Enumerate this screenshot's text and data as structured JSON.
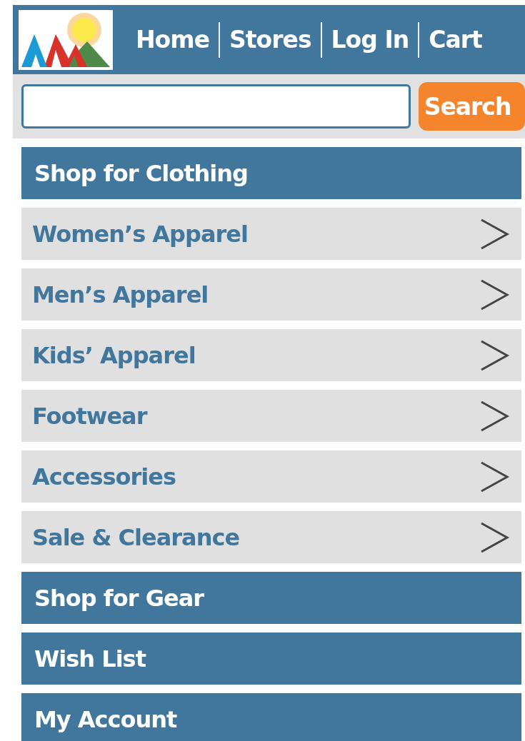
{
  "nav": {
    "links": [
      "Home",
      "Stores",
      "Log In",
      "Cart"
    ]
  },
  "search": {
    "button": "Search"
  },
  "menu": [
    {
      "kind": "heading",
      "label": "Shop for Clothing"
    },
    {
      "kind": "item",
      "label": "Women’s Apparel"
    },
    {
      "kind": "item",
      "label": "Men’s Apparel"
    },
    {
      "kind": "item",
      "label": "Kids’ Apparel"
    },
    {
      "kind": "item",
      "label": "Footwear"
    },
    {
      "kind": "item",
      "label": "Accessories"
    },
    {
      "kind": "item",
      "label": "Sale & Clearance"
    },
    {
      "kind": "heading",
      "label": "Shop for Gear"
    },
    {
      "kind": "heading",
      "label": "Wish List"
    },
    {
      "kind": "heading",
      "label": "My Account"
    }
  ]
}
